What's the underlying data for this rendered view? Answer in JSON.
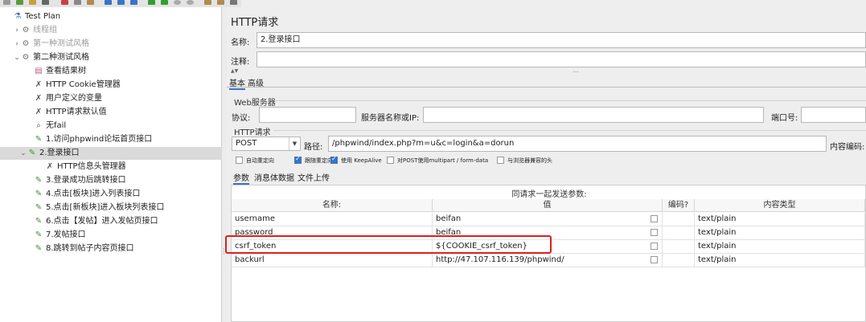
{
  "tree": {
    "nodes": [
      {
        "label": "Test Plan",
        "icon": "flask-icon",
        "chevron": "",
        "dim": false,
        "selected": false
      },
      {
        "label": "线程组",
        "icon": "gear-icon",
        "chevron": "›",
        "dim": true,
        "selected": false
      },
      {
        "label": "第一种测试风格",
        "icon": "gear-icon",
        "chevron": "›",
        "dim": true,
        "selected": false
      },
      {
        "label": "第二种测试风格",
        "icon": "gear-icon",
        "chevron": "⌄",
        "dim": false,
        "selected": false
      },
      {
        "label": "查看结果树",
        "icon": "chart-icon",
        "chevron": "",
        "dim": false,
        "selected": false
      },
      {
        "label": "HTTP Cookie管理器",
        "icon": "wrench-icon",
        "chevron": "",
        "dim": false,
        "selected": false
      },
      {
        "label": "用户定义的变量",
        "icon": "wrench-icon",
        "chevron": "",
        "dim": false,
        "selected": false
      },
      {
        "label": "HTTP请求默认值",
        "icon": "wrench-icon",
        "chevron": "",
        "dim": false,
        "selected": false
      },
      {
        "label": "无fail",
        "icon": "magnifier-icon",
        "chevron": "",
        "dim": false,
        "selected": false
      },
      {
        "label": "1.访问phpwind论坛首页接口",
        "icon": "pipette-icon",
        "chevron": "",
        "dim": false,
        "selected": false
      },
      {
        "label": "2.登录接口",
        "icon": "pipette-icon",
        "chevron": "⌄",
        "dim": false,
        "selected": true
      },
      {
        "label": "HTTP信息头管理器",
        "icon": "wrench-icon",
        "chevron": "",
        "dim": false,
        "selected": false
      },
      {
        "label": "3.登录成功后跳转接口",
        "icon": "pipette-icon",
        "chevron": "",
        "dim": false,
        "selected": false
      },
      {
        "label": "4.点击[板块]进入列表接口",
        "icon": "pipette-icon",
        "chevron": "",
        "dim": false,
        "selected": false
      },
      {
        "label": "5.点击[新板块]进入板块列表接口",
        "icon": "pipette-icon",
        "chevron": "",
        "dim": false,
        "selected": false
      },
      {
        "label": "6.点击【发帖】进入发帖页接口",
        "icon": "pipette-icon",
        "chevron": "",
        "dim": false,
        "selected": false
      },
      {
        "label": "7.发帖接口",
        "icon": "pipette-icon",
        "chevron": "",
        "dim": false,
        "selected": false
      },
      {
        "label": "8.跳转到帖子内容页接口",
        "icon": "pipette-icon",
        "chevron": "",
        "dim": false,
        "selected": false
      }
    ]
  },
  "panel": {
    "title": "HTTP请求",
    "name_label": "名称:",
    "name_value": "2.登录接口",
    "comment_label": "注释:",
    "comment_value": "",
    "tabs": [
      "基本",
      "高级"
    ],
    "web_server": {
      "section": "Web服务器",
      "protocol_label": "协议:",
      "server_label": "服务器名称或IP:",
      "port_label": "端口号:"
    },
    "http_request": {
      "section": "HTTP请求",
      "method": "POST",
      "path_label": "路径:",
      "path_value": "/phpwind/index.php?m=u&c=login&a=dorun",
      "encoding_label": "内容编码:"
    },
    "options": [
      {
        "label": "自动重定向",
        "checked": false
      },
      {
        "label": "跟随重定向",
        "checked": true
      },
      {
        "label": "使用 KeepAlive",
        "checked": true
      },
      {
        "label": "对POST使用multipart / form-data",
        "checked": false
      },
      {
        "label": "与浏览器兼容的头",
        "checked": false
      }
    ],
    "subtabs": [
      "参数",
      "消息体数据",
      "文件上传"
    ],
    "params_table": {
      "caption": "同请求一起发送参数:",
      "headers": [
        "名称:",
        "值",
        "编码?",
        "内容类型"
      ],
      "rows": [
        {
          "name": "username",
          "value": "beifan",
          "encode": false,
          "type": "text/plain"
        },
        {
          "name": "password",
          "value": "beifan",
          "encode": false,
          "type": "text/plain"
        },
        {
          "name": "csrf_token",
          "value": "${COOKIE_csrf_token}",
          "encode": false,
          "type": "text/plain"
        },
        {
          "name": "backurl",
          "value": "http://47.107.116.139/phpwind/",
          "encode": false,
          "type": "text/plain"
        }
      ]
    }
  },
  "colors": {
    "accent": "#3a74c4",
    "highlight": "#e01e1e"
  }
}
